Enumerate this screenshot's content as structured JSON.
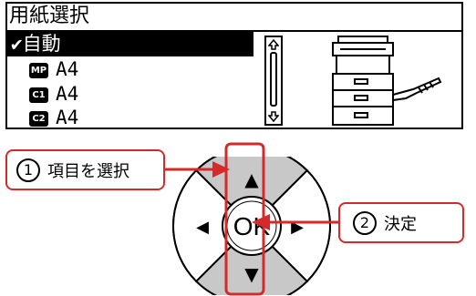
{
  "lcd": {
    "title": "用紙選択",
    "items": [
      {
        "check": "✔",
        "label": "自動",
        "selected": true
      },
      {
        "badge": "MP",
        "label": "A4"
      },
      {
        "badge": "C1",
        "label": "A4"
      },
      {
        "badge": "C2",
        "label": "A4"
      }
    ]
  },
  "pad": {
    "up_label": "▲",
    "down_label": "▼",
    "left_label": "◀",
    "right_label": "▶",
    "ok_label": "OK"
  },
  "callouts": {
    "step1": {
      "number": "1",
      "text": "項目を選択"
    },
    "step2": {
      "number": "2",
      "text": "決定"
    }
  },
  "colors": {
    "accent": "#d62a2a",
    "pad_gray": "#c8c8c8"
  }
}
